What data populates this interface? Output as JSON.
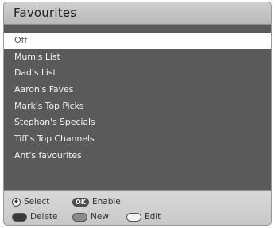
{
  "window": {
    "title": "Favourites"
  },
  "list": {
    "items": [
      {
        "label": "Off",
        "selected": true
      },
      {
        "label": "Mum's List",
        "selected": false
      },
      {
        "label": "Dad's List",
        "selected": false
      },
      {
        "label": "Aaron's Faves",
        "selected": false
      },
      {
        "label": "Mark's Top Picks",
        "selected": false
      },
      {
        "label": "Stephan's Specials",
        "selected": false
      },
      {
        "label": "Tiff's Top Channels",
        "selected": false
      },
      {
        "label": "Ant's favourites",
        "selected": false
      }
    ]
  },
  "footer": {
    "select": {
      "icon": "navigation-dpad-icon",
      "label": "Select"
    },
    "enable": {
      "key": "OK",
      "label": "Enable"
    },
    "delete": {
      "icon": "red-key-icon",
      "label": "Delete",
      "color": "#3a3a3a"
    },
    "new": {
      "icon": "green-key-icon",
      "label": "New",
      "color": "#8a8a8a"
    },
    "edit": {
      "icon": "yellow-key-icon",
      "label": "Edit",
      "color": "#f2f2f2"
    }
  },
  "colors": {
    "panel_bg": "#5a5a5a",
    "title_bar": "#c4c4c4",
    "footer_bg": "#d0d0d0",
    "row_text": "#f2f2f2",
    "selected_bg": "#ffffff",
    "selected_text": "#555555"
  }
}
